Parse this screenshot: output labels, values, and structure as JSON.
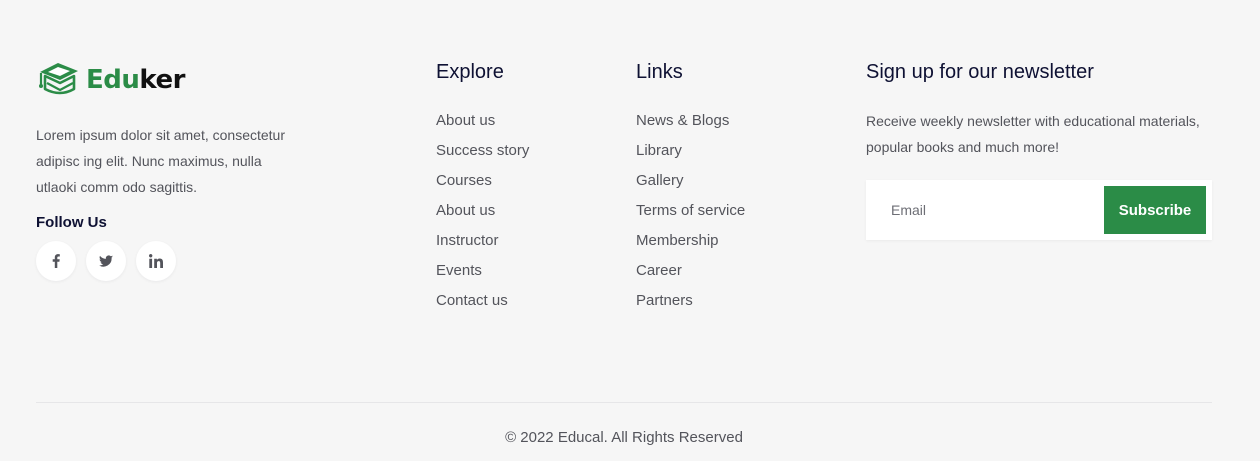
{
  "brand": {
    "logo_part1": "Edu",
    "logo_part2": "ker",
    "description": "Lorem ipsum dolor sit amet, consectetur adipisc ing elit. Nunc maximus, nulla utlaoki comm odo sagittis.",
    "follow_title": "Follow Us",
    "socials": [
      {
        "name": "facebook",
        "icon": "facebook-icon"
      },
      {
        "name": "twitter",
        "icon": "twitter-icon"
      },
      {
        "name": "linkedin",
        "icon": "linkedin-icon"
      }
    ],
    "brand_color": "#2b8c47"
  },
  "explore": {
    "title": "Explore",
    "items": [
      "About us",
      "Success story",
      "Courses",
      "About us",
      "Instructor",
      "Events",
      "Contact us"
    ]
  },
  "links": {
    "title": "Links",
    "items": [
      "News & Blogs",
      "Library",
      "Gallery",
      "Terms of service",
      "Membership",
      "Career",
      "Partners"
    ]
  },
  "newsletter": {
    "title": "Sign up for our newsletter",
    "description": "Receive weekly newsletter with educational materials, popular books and much more!",
    "email_placeholder": "Email",
    "email_value": "",
    "subscribe_label": "Subscribe"
  },
  "copyright": "© 2022 Educal. All Rights Reserved"
}
